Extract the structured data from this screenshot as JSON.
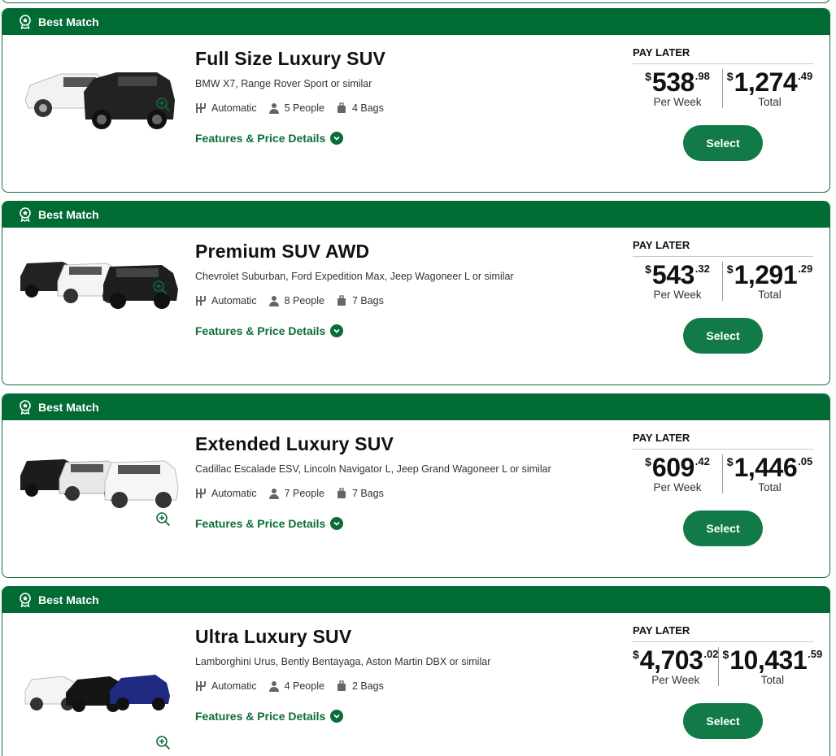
{
  "colors": {
    "brand_green": "#006b33",
    "button_green": "#127a47",
    "link_green": "#0d6b3a"
  },
  "icons": {
    "badge": "award-ribbon-icon",
    "transmission": "gear-shift-icon",
    "people": "person-icon",
    "bags": "luggage-icon",
    "zoom": "zoom-in-icon",
    "chevron": "chevron-down-icon"
  },
  "cards": [
    {
      "badge": "Best Match",
      "title": "Full Size Luxury SUV",
      "models": "BMW X7, Range Rover Sport or similar",
      "transmission": "Automatic",
      "people": "5 People",
      "bags": "4 Bags",
      "features_link": "Features & Price Details",
      "pay_label": "PAY LATER",
      "week_currency": "$",
      "week_whole": "538",
      "week_cents": ".98",
      "week_label": "Per Week",
      "total_currency": "$",
      "total_whole": "1,274",
      "total_cents": ".49",
      "total_label": "Total",
      "select_label": "Select"
    },
    {
      "badge": "Best Match",
      "title": "Premium SUV AWD",
      "models": "Chevrolet Suburban, Ford Expedition Max, Jeep Wagoneer L or similar",
      "transmission": "Automatic",
      "people": "8 People",
      "bags": "7 Bags",
      "features_link": "Features & Price Details",
      "pay_label": "PAY LATER",
      "week_currency": "$",
      "week_whole": "543",
      "week_cents": ".32",
      "week_label": "Per Week",
      "total_currency": "$",
      "total_whole": "1,291",
      "total_cents": ".29",
      "total_label": "Total",
      "select_label": "Select"
    },
    {
      "badge": "Best Match",
      "title": "Extended Luxury SUV",
      "models": "Cadillac Escalade ESV, Lincoln Navigator L, Jeep Grand Wagoneer L or similar",
      "transmission": "Automatic",
      "people": "7 People",
      "bags": "7 Bags",
      "features_link": "Features & Price Details",
      "pay_label": "PAY LATER",
      "week_currency": "$",
      "week_whole": "609",
      "week_cents": ".42",
      "week_label": "Per Week",
      "total_currency": "$",
      "total_whole": "1,446",
      "total_cents": ".05",
      "total_label": "Total",
      "select_label": "Select"
    },
    {
      "badge": "Best Match",
      "title": "Ultra Luxury SUV",
      "models": "Lamborghini Urus, Bently Bentayaga, Aston Martin DBX or similar",
      "transmission": "Automatic",
      "people": "4 People",
      "bags": "2 Bags",
      "features_link": "Features & Price Details",
      "pay_label": "PAY LATER",
      "week_currency": "$",
      "week_whole": "4,703",
      "week_cents": ".02",
      "week_label": "Per Week",
      "total_currency": "$",
      "total_whole": "10,431",
      "total_cents": ".59",
      "total_label": "Total",
      "select_label": "Select"
    }
  ]
}
